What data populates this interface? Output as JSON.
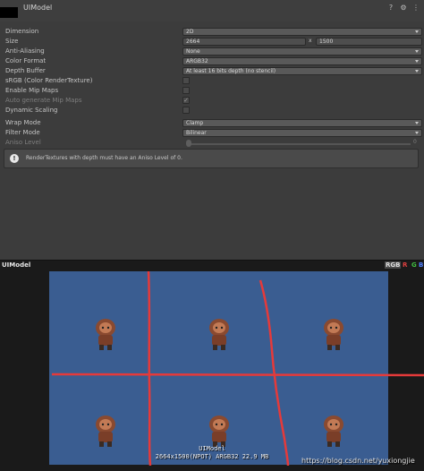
{
  "header": {
    "title": "UIModel"
  },
  "properties": [
    {
      "label": "Dimension",
      "type": "dropdown",
      "value": "2D"
    },
    {
      "label": "Size",
      "type": "size",
      "width": "2664",
      "x": "x",
      "height": "1500"
    },
    {
      "label": "Anti-Aliasing",
      "type": "dropdown",
      "value": "None"
    },
    {
      "label": "Color Format",
      "type": "dropdown",
      "value": "ARGB32"
    },
    {
      "label": "Depth Buffer",
      "type": "dropdown",
      "value": "At least 16 bits depth (no stencil)"
    },
    {
      "label": "sRGB (Color RenderTexture)",
      "type": "checkbox",
      "checked": false
    },
    {
      "label": "Enable Mip Maps",
      "type": "checkbox",
      "checked": false
    },
    {
      "label": "Auto generate Mip Maps",
      "type": "checkbox",
      "checked": true,
      "disabled": true
    },
    {
      "label": "Dynamic Scaling",
      "type": "checkbox",
      "checked": false
    },
    {
      "label": "Wrap Mode",
      "type": "dropdown",
      "value": "Clamp"
    },
    {
      "label": "Filter Mode",
      "type": "dropdown",
      "value": "Bilinear"
    },
    {
      "label": "Aniso Level",
      "type": "slider",
      "value": "0",
      "disabled": true
    }
  ],
  "help": {
    "text": "RenderTextures with depth must have an Aniso Level of 0."
  },
  "preview": {
    "title": "UIModel",
    "channels": {
      "rgb": "RGB",
      "r": "R",
      "g": "G",
      "b": "B"
    },
    "caption_name": "UIModel",
    "caption_info": "2664x1500(NPOT)  ARGB32  22.9 MB"
  },
  "watermark": "https://blog.csdn.net/yuxiongjie",
  "colors": {
    "rt_background": "#3a5d91",
    "annotation": "#e53a3a"
  }
}
